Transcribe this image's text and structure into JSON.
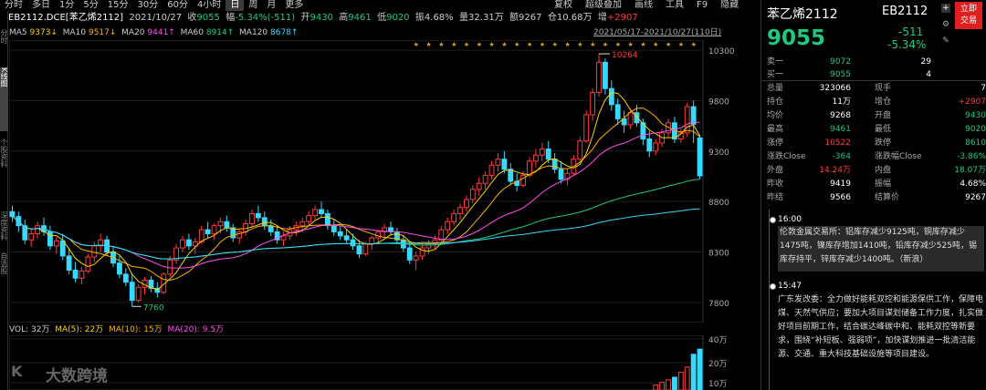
{
  "toolbar": {
    "periods": [
      "分时",
      "多日",
      "1分",
      "5分",
      "15分",
      "30分",
      "60分",
      "4小时",
      "日",
      "周",
      "月",
      "更多"
    ],
    "active": "日",
    "tools": [
      "复权",
      "超级叠加",
      "画线",
      "工具",
      "F9",
      "隐藏"
    ]
  },
  "side_tabs": [
    "分时",
    "K线图",
    "个股资料",
    "深度资料",
    "自选股"
  ],
  "info": {
    "code": "EB2112.DCE[苯乙烯2112]",
    "date": "2021/10/27",
    "close_label": "收",
    "close": "9055",
    "chg_label": "幅",
    "chg": "-5.34%(-511)",
    "open_label": "开",
    "open": "9430",
    "high_label": "高",
    "high": "9461",
    "low_label": "低",
    "low": "9020",
    "amp_label": "振",
    "amp": "4.68%",
    "vol_label": "量",
    "vol": "32.31万",
    "amt_label": "额",
    "amt": "9267",
    "oi_label": "仓",
    "oi": "10.68万",
    "inc_label": "增",
    "inc": "+2907"
  },
  "ma": {
    "ma5_label": "MA5",
    "ma5": "9373↓",
    "ma10_label": "MA10",
    "ma10": "9517↓",
    "ma20_label": "MA20",
    "ma20": "9441↑",
    "ma60_label": "MA60",
    "ma60": "8914↑",
    "ma120_label": "MA120",
    "ma120": "8678↑"
  },
  "range": "2021/05/17-2021/10/27(110日)",
  "axis": {
    "y": [
      "10300",
      "9800",
      "9300",
      "8800",
      "8300",
      "7800"
    ],
    "high": "10264",
    "low": "7760"
  },
  "vol": {
    "label": "VOL: 32万",
    "ma5": "MA(5): 22万",
    "ma10": "MA(10): 15万",
    "ma20": "MA(20): 9.5万",
    "axis": [
      "40万",
      "20万",
      "10万"
    ]
  },
  "watermark": "大数跨境",
  "quote": {
    "name": "苯乙烯2112",
    "code": "EB2112",
    "price": "9055",
    "change": "-511",
    "pct": "-5.34%",
    "btn_top": "立即",
    "btn_bot": "交易"
  },
  "orderbook": [
    {
      "l": "卖一",
      "p": "9072",
      "v": "29"
    },
    {
      "l": "买一",
      "p": "9055",
      "v": "4"
    }
  ],
  "stats": [
    {
      "l": "总量",
      "v": "323066",
      "c": "wh",
      "l2": "现手",
      "v2": "7",
      "c2": "wh"
    },
    {
      "l": "持仓",
      "v": "11万",
      "c": "wh",
      "l2": "增仓",
      "v2": "+2907",
      "c2": "red"
    },
    {
      "l": "均价",
      "v": "9268",
      "c": "wh",
      "l2": "开盘",
      "v2": "9430",
      "c2": "green"
    },
    {
      "l": "最高",
      "v": "9461",
      "c": "green",
      "l2": "最低",
      "v2": "9020",
      "c2": "green"
    },
    {
      "l": "涨停",
      "v": "10522",
      "c": "red",
      "l2": "跌停",
      "v2": "8610",
      "c2": "green"
    },
    {
      "l": "涨跌Close",
      "v": "-364",
      "c": "green",
      "l2": "涨跌幅Close",
      "v2": "-3.86%",
      "c2": "green"
    },
    {
      "l": "外盘",
      "v": "14.24万",
      "c": "red",
      "l2": "内盘",
      "v2": "18.07万",
      "c2": "green"
    },
    {
      "l": "昨收",
      "v": "9419",
      "c": "wh",
      "l2": "振幅",
      "v2": "4.68%",
      "c2": "wh"
    },
    {
      "l": "昨结",
      "v": "9566",
      "c": "wh",
      "l2": "结算价",
      "v2": "9267",
      "c2": "wh"
    }
  ],
  "news": [
    {
      "time": "16:00",
      "text": "伦敦金属交易所：铝库存减少9125吨，铜库存减少1475吨，镍库存增加1410吨，铅库存减少525吨，锡库存持平，锌库存减少1400吨。（新浪）"
    },
    {
      "time": "15:47",
      "text": "广东发改委：全力做好能耗双控和能源保供工作，保障电煤、天然气供应；要加大项目谋划储备工作力度，扎实做好项目前期工作，结合碳达峰碳中和、能耗双控等新要求，围绕“补短板、强弱项”，加快谋划推进一批清洁能源、交通、重大科技基础设施等项目建设。"
    }
  ],
  "chart_data": {
    "type": "candlestick",
    "ylim": [
      7600,
      10400
    ],
    "ohlc": [
      [
        8700,
        8760,
        8600,
        8650
      ],
      [
        8650,
        8700,
        8500,
        8560
      ],
      [
        8560,
        8620,
        8380,
        8420
      ],
      [
        8420,
        8520,
        8350,
        8480
      ],
      [
        8480,
        8600,
        8430,
        8560
      ],
      [
        8560,
        8640,
        8460,
        8500
      ],
      [
        8500,
        8560,
        8320,
        8360
      ],
      [
        8360,
        8450,
        8280,
        8410
      ],
      [
        8410,
        8480,
        8220,
        8260
      ],
      [
        8260,
        8340,
        8080,
        8120
      ],
      [
        8120,
        8200,
        8000,
        8040
      ],
      [
        8040,
        8150,
        7980,
        8110
      ],
      [
        8110,
        8280,
        8090,
        8250
      ],
      [
        8250,
        8400,
        8200,
        8360
      ],
      [
        8360,
        8480,
        8300,
        8420
      ],
      [
        8420,
        8460,
        8260,
        8300
      ],
      [
        8300,
        8360,
        8150,
        8190
      ],
      [
        8190,
        8260,
        8040,
        8080
      ],
      [
        8080,
        8140,
        7960,
        8000
      ],
      [
        8000,
        8080,
        7760,
        7820
      ],
      [
        7820,
        7980,
        7800,
        7950
      ],
      [
        7950,
        8050,
        7880,
        8020
      ],
      [
        8020,
        8060,
        7900,
        7940
      ],
      [
        7940,
        8000,
        7850,
        7900
      ],
      [
        7900,
        8100,
        7880,
        8080
      ],
      [
        8080,
        8260,
        8050,
        8220
      ],
      [
        8220,
        8380,
        8180,
        8340
      ],
      [
        8340,
        8460,
        8300,
        8420
      ],
      [
        8420,
        8480,
        8320,
        8360
      ],
      [
        8360,
        8440,
        8280,
        8400
      ],
      [
        8400,
        8560,
        8380,
        8520
      ],
      [
        8520,
        8600,
        8440,
        8480
      ],
      [
        8480,
        8580,
        8420,
        8560
      ],
      [
        8560,
        8640,
        8480,
        8600
      ],
      [
        8600,
        8660,
        8500,
        8540
      ],
      [
        8540,
        8580,
        8400,
        8440
      ],
      [
        8440,
        8520,
        8380,
        8500
      ],
      [
        8500,
        8620,
        8460,
        8580
      ],
      [
        8580,
        8720,
        8540,
        8680
      ],
      [
        8680,
        8760,
        8600,
        8640
      ],
      [
        8640,
        8700,
        8520,
        8560
      ],
      [
        8560,
        8620,
        8460,
        8500
      ],
      [
        8500,
        8560,
        8380,
        8420
      ],
      [
        8420,
        8500,
        8360,
        8460
      ],
      [
        8460,
        8560,
        8420,
        8520
      ],
      [
        8520,
        8600,
        8460,
        8560
      ],
      [
        8560,
        8640,
        8500,
        8600
      ],
      [
        8600,
        8700,
        8560,
        8660
      ],
      [
        8660,
        8760,
        8620,
        8720
      ],
      [
        8720,
        8800,
        8640,
        8680
      ],
      [
        8680,
        8720,
        8520,
        8560
      ],
      [
        8560,
        8620,
        8460,
        8500
      ],
      [
        8500,
        8560,
        8420,
        8460
      ],
      [
        8460,
        8520,
        8380,
        8420
      ],
      [
        8420,
        8480,
        8320,
        8360
      ],
      [
        8360,
        8420,
        8240,
        8280
      ],
      [
        8280,
        8400,
        8260,
        8380
      ],
      [
        8380,
        8460,
        8320,
        8440
      ],
      [
        8440,
        8520,
        8380,
        8500
      ],
      [
        8500,
        8580,
        8440,
        8540
      ],
      [
        8540,
        8600,
        8460,
        8500
      ],
      [
        8500,
        8540,
        8380,
        8420
      ],
      [
        8420,
        8460,
        8300,
        8340
      ],
      [
        8340,
        8400,
        8180,
        8220
      ],
      [
        8220,
        8300,
        8120,
        8260
      ],
      [
        8260,
        8380,
        8220,
        8340
      ],
      [
        8340,
        8420,
        8280,
        8380
      ],
      [
        8380,
        8460,
        8320,
        8420
      ],
      [
        8420,
        8560,
        8400,
        8520
      ],
      [
        8520,
        8640,
        8480,
        8600
      ],
      [
        8600,
        8720,
        8560,
        8680
      ],
      [
        8680,
        8780,
        8620,
        8740
      ],
      [
        8740,
        8860,
        8700,
        8820
      ],
      [
        8820,
        8960,
        8780,
        8920
      ],
      [
        8920,
        9040,
        8860,
        8980
      ],
      [
        8980,
        9100,
        8920,
        9060
      ],
      [
        9060,
        9200,
        9020,
        9160
      ],
      [
        9160,
        9280,
        9100,
        9220
      ],
      [
        9220,
        9300,
        9080,
        9120
      ],
      [
        9120,
        9180,
        8960,
        9000
      ],
      [
        9000,
        9080,
        8900,
        8960
      ],
      [
        8960,
        9100,
        8940,
        9060
      ],
      [
        9060,
        9240,
        9040,
        9200
      ],
      [
        9200,
        9320,
        9140,
        9260
      ],
      [
        9260,
        9380,
        9200,
        9320
      ],
      [
        9320,
        9400,
        9180,
        9220
      ],
      [
        9220,
        9280,
        9080,
        9120
      ],
      [
        9120,
        9200,
        8980,
        9020
      ],
      [
        9020,
        9120,
        8960,
        9080
      ],
      [
        9080,
        9260,
        9060,
        9220
      ],
      [
        9220,
        9440,
        9200,
        9400
      ],
      [
        9400,
        9700,
        9380,
        9660
      ],
      [
        9660,
        9920,
        9600,
        9880
      ],
      [
        9880,
        10264,
        9840,
        10180
      ],
      [
        10180,
        10220,
        9860,
        9920
      ],
      [
        9920,
        10000,
        9700,
        9760
      ],
      [
        9760,
        9820,
        9560,
        9620
      ],
      [
        9620,
        9700,
        9480,
        9560
      ],
      [
        9560,
        9720,
        9520,
        9680
      ],
      [
        9680,
        9760,
        9540,
        9580
      ],
      [
        9580,
        9620,
        9360,
        9420
      ],
      [
        9420,
        9500,
        9240,
        9300
      ],
      [
        9300,
        9420,
        9260,
        9380
      ],
      [
        9380,
        9520,
        9340,
        9480
      ],
      [
        9480,
        9620,
        9440,
        9580
      ],
      [
        9580,
        9640,
        9380,
        9420
      ],
      [
        9420,
        9520,
        9380,
        9480
      ],
      [
        9480,
        9780,
        9440,
        9740
      ],
      [
        9740,
        9800,
        9380,
        9566
      ],
      [
        9430,
        9461,
        9020,
        9055
      ]
    ]
  }
}
